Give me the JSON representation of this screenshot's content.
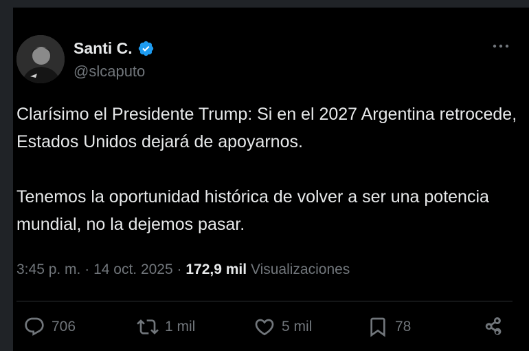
{
  "user": {
    "display_name": "Santi C.",
    "handle": "@slcaputo",
    "verified": true
  },
  "tweet": {
    "paragraph_1": "Clarísimo el Presidente Trump: Si en el 2027 Argentina retrocede, Estados Unidos dejará de apoyarnos.",
    "paragraph_2": "Tenemos la oportunidad histórica de volver a ser una potencia mundial, no la dejemos pasar."
  },
  "meta": {
    "time": "3:45 p. m.",
    "separator": "·",
    "date": "14 oct. 2025",
    "views_count": "172,9 mil",
    "views_label": "Visualizaciones"
  },
  "actions": {
    "replies": "706",
    "reposts": "1 mil",
    "likes": "5 mil",
    "bookmarks": "78"
  },
  "icons": {
    "verified": "verified-badge-icon",
    "more": "more-options-icon",
    "reply": "reply-icon",
    "repost": "repost-icon",
    "like": "heart-icon",
    "bookmark": "bookmark-icon",
    "share": "share-icon"
  },
  "colors": {
    "background": "#000000",
    "text_primary": "#e7e9ea",
    "text_secondary": "#71767b",
    "verified_blue": "#1d9bf0",
    "divider": "#2f3336"
  }
}
